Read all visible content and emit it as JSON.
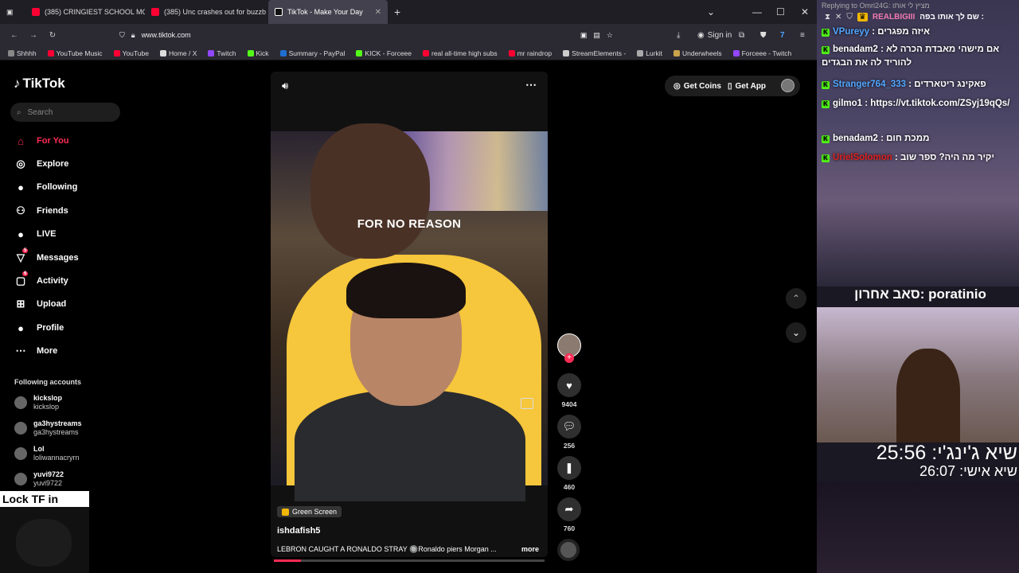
{
  "browser": {
    "tabs": [
      {
        "title": "(385) CRINGIEST SCHOOL MOM",
        "fav_color": "#ff0033"
      },
      {
        "title": "(385) Unc crashes out for buzzb",
        "fav_color": "#ff0033"
      },
      {
        "title": "TikTok - Make Your Day",
        "fav_color": "#111111"
      }
    ],
    "new_tab": "+",
    "url": "www.tiktok.com",
    "sign_in": "Sign in",
    "bookmarks": [
      {
        "label": "Shhhh",
        "color": "#888888"
      },
      {
        "label": "YouTube Music",
        "color": "#ff0033"
      },
      {
        "label": "YouTube",
        "color": "#ff0033"
      },
      {
        "label": "Home / X",
        "color": "#dddddd"
      },
      {
        "label": "Twitch",
        "color": "#9146ff"
      },
      {
        "label": "Kick",
        "color": "#53fc18"
      },
      {
        "label": "Summary - PayPal",
        "color": "#1f6fd0"
      },
      {
        "label": "KICK - Forceee",
        "color": "#53fc18"
      },
      {
        "label": "real all-time high subs",
        "color": "#ff0033"
      },
      {
        "label": "mr raindrop",
        "color": "#ff0033"
      },
      {
        "label": "StreamElements -",
        "color": "#cccccc"
      },
      {
        "label": "Lurkit",
        "color": "#aaaaaa"
      },
      {
        "label": "Underwheels",
        "color": "#c9a24a"
      },
      {
        "label": "Forceee - Twitch",
        "color": "#9146ff"
      }
    ]
  },
  "tiktok": {
    "logo": "TikTok",
    "search_placeholder": "Search",
    "nav": [
      {
        "label": "For You",
        "icon": "home-icon",
        "glyph": "⌂",
        "active": true
      },
      {
        "label": "Explore",
        "icon": "compass-icon",
        "glyph": "◎"
      },
      {
        "label": "Following",
        "icon": "following-avatar-icon",
        "glyph": "●"
      },
      {
        "label": "Friends",
        "icon": "friends-icon",
        "glyph": "⚇"
      },
      {
        "label": "LIVE",
        "icon": "live-icon",
        "glyph": "●"
      },
      {
        "label": "Messages",
        "icon": "messages-icon",
        "glyph": "▽",
        "badge": "5"
      },
      {
        "label": "Activity",
        "icon": "activity-icon",
        "glyph": "▢",
        "badge": "6"
      },
      {
        "label": "Upload",
        "icon": "upload-icon",
        "glyph": "⊞"
      },
      {
        "label": "Profile",
        "icon": "profile-icon",
        "glyph": "●"
      },
      {
        "label": "More",
        "icon": "more-icon",
        "glyph": "⋯"
      }
    ],
    "following_title": "Following accounts",
    "following": [
      {
        "name": "kickslop",
        "user": "kickslop"
      },
      {
        "name": "ga3hystreams",
        "user": "ga3hystreams"
      },
      {
        "name": "Lol",
        "user": "loliwannacryrn"
      },
      {
        "name": "yuvi9722",
        "user": "yuvi9722"
      }
    ],
    "get_coins": "Get Coins",
    "get_app": "Get App",
    "video": {
      "overlay_text": "FOR NO REASON",
      "effect_label": "Green Screen",
      "author": "ishdafish5",
      "caption": "LEBRON CAUGHT A RONALDO STRAY 🔘Ronaldo piers Morgan ...",
      "more": "more",
      "progress": 0.1
    },
    "actions": {
      "likes": "9404",
      "comments": "256",
      "saves": "460",
      "shares": "760"
    }
  },
  "overlay": {
    "lock_label": "Lock TF in",
    "reply_text": "Replying to Omri24G: מציץ לי אותו",
    "top_user": "REALBIGIII",
    "top_msg": "שם לך אותו בפה :",
    "messages": [
      {
        "user": "VPureyy",
        "text": "איזה מפגרים",
        "color": "blue"
      },
      {
        "user": "benadam2",
        "text": "אם מישהי מאבדת הכרה לא להוריד לה את הבגדים",
        "color": "white"
      },
      {
        "user": "Stranger764_333",
        "text": "פאקינג ריטארדים",
        "color": "blue"
      },
      {
        "user": "gilmo1",
        "text": "https://vt.tiktok.com/ZSyj19qQs/",
        "color": "white"
      },
      {
        "user": "benadam2",
        "text": "ממכת חום",
        "color": "white"
      },
      {
        "user": "UrielSolomon",
        "text": "יקיר מה היה? ספר שוב",
        "color": "red"
      }
    ],
    "streamer_line": "סאב אחרון: poratinio",
    "timer_main": "שיא ג'ינג'י: 25:56",
    "timer_personal": "שיא אישי: 26:07"
  }
}
